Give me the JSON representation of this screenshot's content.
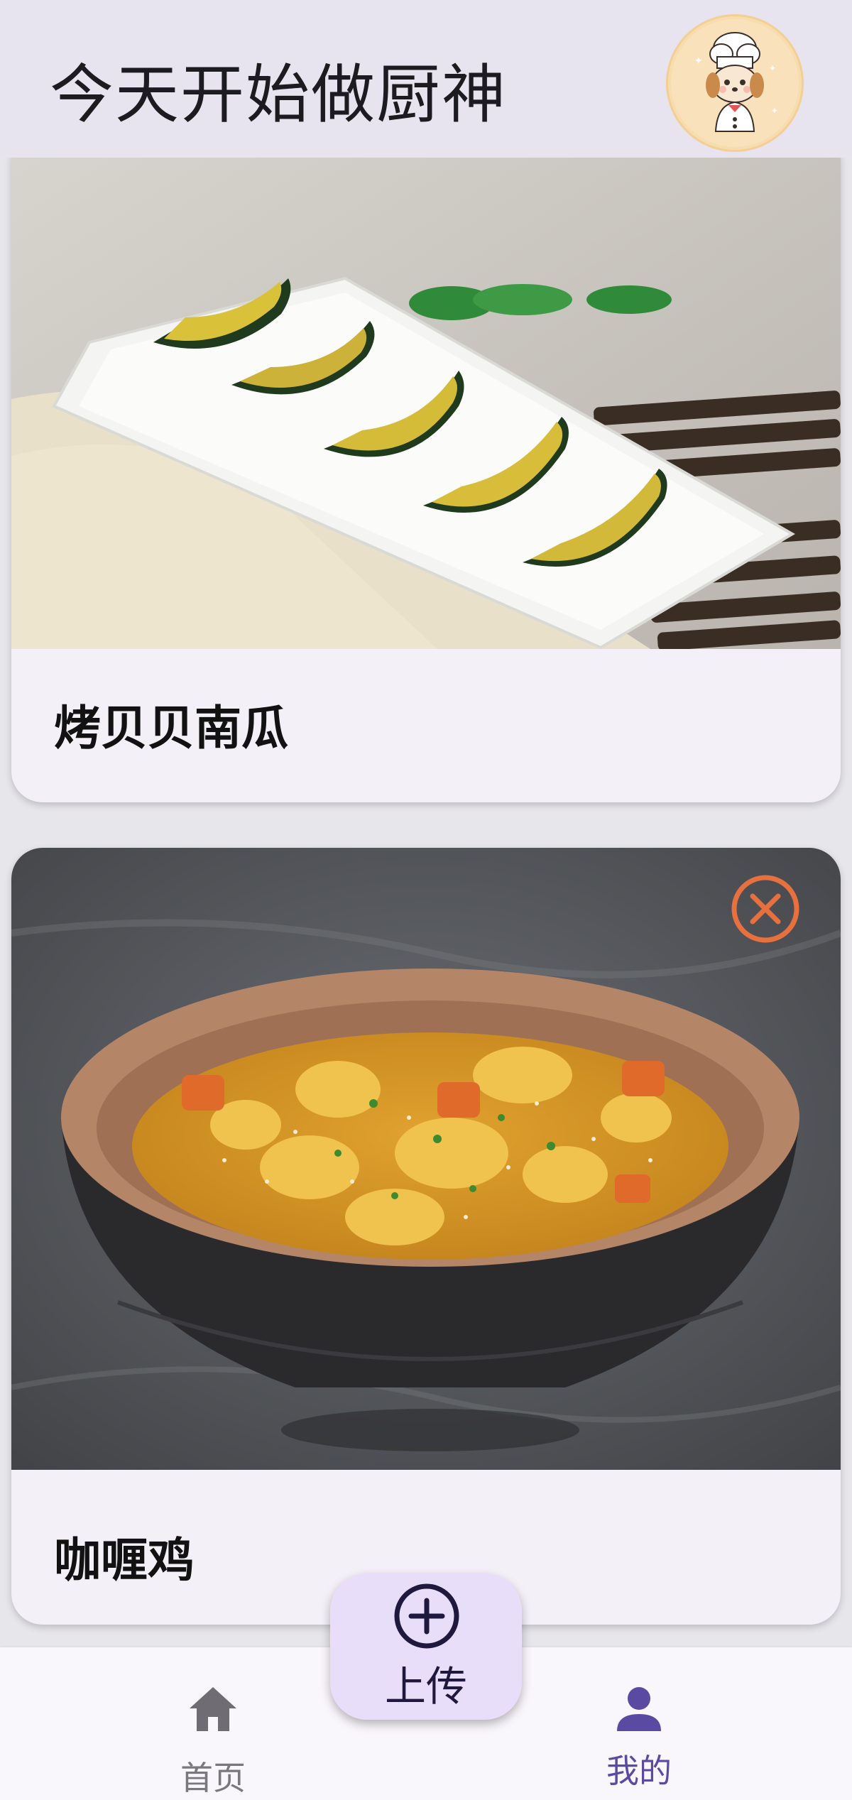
{
  "header": {
    "title": "今天开始做厨神",
    "avatar_icon": "chef-avatar-icon"
  },
  "feed": {
    "cards": [
      {
        "title": "烤贝贝南瓜",
        "image": "roasted-pumpkin-photo"
      },
      {
        "title": "咖喱鸡",
        "image": "curry-chicken-photo",
        "delete_icon": "close-circle-icon"
      }
    ]
  },
  "fab": {
    "label": "上传",
    "icon": "plus-circle-icon"
  },
  "bottom_nav": {
    "items": [
      {
        "label": "首页",
        "icon": "home-icon",
        "active": false
      },
      {
        "label": "我的",
        "icon": "person-icon",
        "active": true
      }
    ]
  },
  "colors": {
    "header_bg": "#e8e4ef",
    "card_bg": "#f3f1f7",
    "fab_bg": "#e9defa",
    "active_nav": "#5a4aa2",
    "delete_accent": "#e6703e"
  }
}
